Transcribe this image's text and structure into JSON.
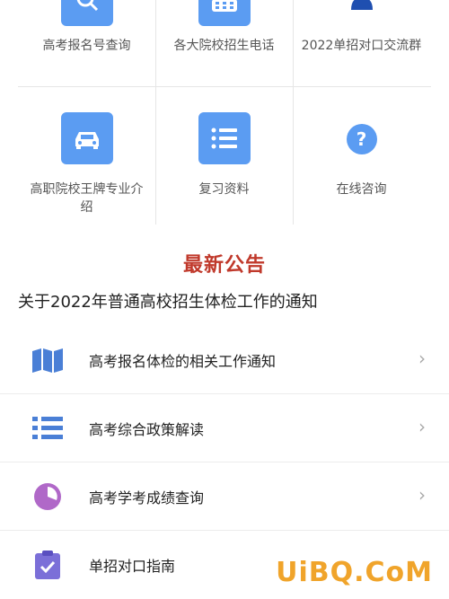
{
  "grid": {
    "items": [
      {
        "label": "高考报名号查询",
        "icon": "search-icon"
      },
      {
        "label": "各大院校招生电话",
        "icon": "phone-keypad-icon"
      },
      {
        "label": "2022单招对口交流群",
        "icon": "user-group-icon"
      },
      {
        "label": "高职院校王牌专业介绍",
        "icon": "car-icon"
      },
      {
        "label": "复习资料",
        "icon": "list-icon"
      },
      {
        "label": "在线咨询",
        "icon": "question-icon"
      }
    ]
  },
  "announcements": {
    "title": "最新公告",
    "notice": "关于2022年普通高校招生体检工作的通知"
  },
  "menu": {
    "items": [
      {
        "label": "高考报名体检的相关工作通知",
        "icon": "map-icon"
      },
      {
        "label": "高考综合政策解读",
        "icon": "list-icon"
      },
      {
        "label": "高考学考成绩查询",
        "icon": "pie-chart-icon"
      },
      {
        "label": "单招对口指南",
        "icon": "clipboard-check-icon"
      }
    ],
    "chevron": "›"
  },
  "watermark": "UiBQ.CoM",
  "colors": {
    "accent": "#5b9cf2",
    "title": "#c0392b",
    "icon_blue": "#4a7fd6",
    "icon_purple": "#b068c8"
  }
}
